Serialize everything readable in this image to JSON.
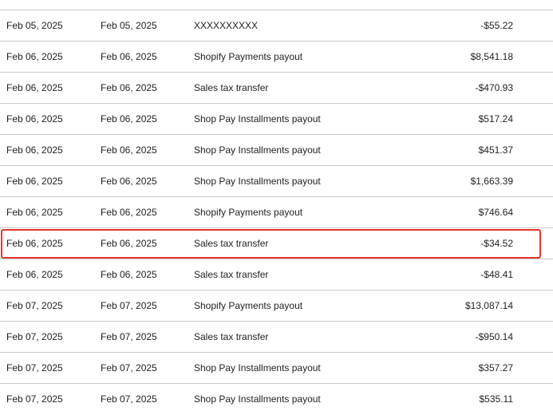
{
  "transactions": [
    {
      "date": "Feb 05, 2025",
      "posted": "Feb 05, 2025",
      "description": "XXXXXXXXXX",
      "amount": "-$55.22"
    },
    {
      "date": "Feb 06, 2025",
      "posted": "Feb 06, 2025",
      "description": "Shopify Payments payout",
      "amount": "$8,541.18"
    },
    {
      "date": "Feb 06, 2025",
      "posted": "Feb 06, 2025",
      "description": "Sales tax transfer",
      "amount": "-$470.93"
    },
    {
      "date": "Feb 06, 2025",
      "posted": "Feb 06, 2025",
      "description": "Shop Pay Installments payout",
      "amount": "$517.24"
    },
    {
      "date": "Feb 06, 2025",
      "posted": "Feb 06, 2025",
      "description": "Shop Pay Installments payout",
      "amount": "$451.37"
    },
    {
      "date": "Feb 06, 2025",
      "posted": "Feb 06, 2025",
      "description": "Shop Pay Installments payout",
      "amount": "$1,663.39"
    },
    {
      "date": "Feb 06, 2025",
      "posted": "Feb 06, 2025",
      "description": "Shopify Payments payout",
      "amount": "$746.64"
    },
    {
      "date": "Feb 06, 2025",
      "posted": "Feb 06, 2025",
      "description": "Sales tax transfer",
      "amount": "-$34.52"
    },
    {
      "date": "Feb 06, 2025",
      "posted": "Feb 06, 2025",
      "description": "Sales tax transfer",
      "amount": "-$48.41"
    },
    {
      "date": "Feb 07, 2025",
      "posted": "Feb 07, 2025",
      "description": "Shopify Payments payout",
      "amount": "$13,087.14"
    },
    {
      "date": "Feb 07, 2025",
      "posted": "Feb 07, 2025",
      "description": "Sales tax transfer",
      "amount": "-$950.14"
    },
    {
      "date": "Feb 07, 2025",
      "posted": "Feb 07, 2025",
      "description": "Shop Pay Installments payout",
      "amount": "$357.27"
    },
    {
      "date": "Feb 07, 2025",
      "posted": "Feb 07, 2025",
      "description": "Shop Pay Installments payout",
      "amount": "$535.11"
    }
  ],
  "highlighted_row": 7,
  "colors": {
    "highlight": "#e5352b",
    "divider": "#c9c9c9",
    "text": "#1f1f1f"
  }
}
